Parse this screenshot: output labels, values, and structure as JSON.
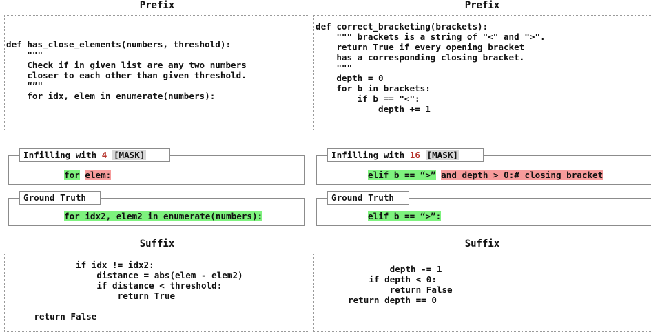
{
  "left": {
    "prefix_heading": "Prefix",
    "prefix_code": "\ndef has_close_elements(numbers, threshold):\n    \"\"\"\n    Check if in given list are any two numbers\n    closer to each other than given threshold.\n    “”\"\n    for idx, elem in enumerate(numbers):",
    "infill_label": "Infilling with",
    "infill_count": "4",
    "mask_label": "[MASK]",
    "infill_tokens": [
      {
        "text": "for",
        "color": "green"
      },
      {
        "text": " ",
        "color": "none"
      },
      {
        "text": "elem:",
        "color": "red"
      }
    ],
    "gt_label": "Ground Truth",
    "gt_text": "for idx2, elem2 in enumerate(numbers):",
    "suffix_heading": "Suffix",
    "suffix_code": "            if idx != idx2:\n                distance = abs(elem - elem2)\n                if distance < threshold:\n                    return True\n\n    return False"
  },
  "right": {
    "prefix_heading": "Prefix",
    "prefix_code": "def correct_bracketing(brackets):\n    \"\"\" brackets is a string of \"<\" and \">\".\n    return True if every opening bracket\n    has a corresponding closing bracket.\n    \"\"\"\n    depth = 0\n    for b in brackets:\n        if b == \"<\":\n            depth += 1",
    "infill_label": "Infilling with",
    "infill_count": "16",
    "mask_label": "[MASK]",
    "infill_green": "elif b == “>”",
    "infill_red": "and depth > 0:# closing bracket",
    "gt_label": "Ground Truth",
    "gt_text": "elif b == “>”:",
    "suffix_heading": "Suffix",
    "suffix_code": "        depth -= 1\n    if depth < 0:\n        return False\nreturn depth == 0"
  },
  "colors": {
    "green_highlight": "#7ef27e",
    "red_highlight": "#f79b9b",
    "count_red": "#b5322a",
    "mask_gray": "#d9d9d9"
  }
}
